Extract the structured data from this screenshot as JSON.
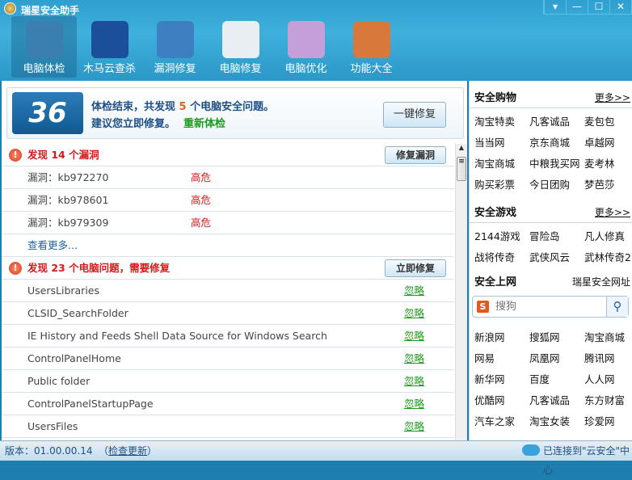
{
  "window": {
    "title": "瑞星安全助手",
    "buttons": [
      "▾",
      "—",
      "☐",
      "✕"
    ]
  },
  "toolbar": [
    {
      "label": "电脑体检",
      "icon": "monitor-pulse-icon",
      "color": "#3a7fb0",
      "active": true
    },
    {
      "label": "木马云查杀",
      "icon": "shield-icon",
      "color": "#1b4f9a"
    },
    {
      "label": "漏洞修复",
      "icon": "windows-refresh-icon",
      "color": "#3d7fc0"
    },
    {
      "label": "电脑修复",
      "icon": "checklist-icon",
      "color": "#e8eef2"
    },
    {
      "label": "电脑优化",
      "icon": "monitor-wand-icon",
      "color": "#c5a0d8"
    },
    {
      "label": "功能大全",
      "icon": "disc-box-icon",
      "color": "#d8783a"
    }
  ],
  "banner": {
    "score": "36",
    "msg_prefix": "体检结束，共发现 ",
    "count": "5",
    "msg_suffix": " 个电脑安全问题。",
    "advice": "建议您立即修复。",
    "rescan": "重新体检",
    "fix_all": "一键修复"
  },
  "vuln_section": {
    "title": "发现 14 个漏洞",
    "button": "修复漏洞",
    "items": [
      {
        "name": "漏洞：kb972270",
        "level": "高危"
      },
      {
        "name": "漏洞：kb978601",
        "level": "高危"
      },
      {
        "name": "漏洞：kb979309",
        "level": "高危"
      }
    ],
    "more": "查看更多..."
  },
  "problem_section": {
    "title": "发现 23 个电脑问题，需要修复",
    "button": "立即修复",
    "ignore": "忽略",
    "items": [
      "UsersLibraries",
      "CLSID_SearchFolder",
      "IE History and Feeds Shell Data Source for Windows Search",
      "ControlPanelHome",
      "Public folder",
      "ControlPanelStartupPage",
      "UsersFiles"
    ]
  },
  "sidebar": {
    "shopping": {
      "title": "安全购物",
      "more": "更多>>",
      "links": [
        "淘宝特卖",
        "凡客诚品",
        "麦包包",
        "当当网",
        "京东商城",
        "卓越网",
        "淘宝商城",
        "中粮我买网",
        "麦考林",
        "购买彩票",
        "今日团购",
        "梦芭莎"
      ]
    },
    "games": {
      "title": "安全游戏",
      "more": "更多>>",
      "links": [
        "2144游戏",
        "冒险岛",
        "凡人修真",
        "战将传奇",
        "武侠风云",
        "武林传奇2"
      ]
    },
    "web": {
      "title": "安全上网",
      "more": "瑞星安全网址",
      "search_placeholder": "搜狗",
      "links": [
        "新浪网",
        "搜狐网",
        "淘宝商城",
        "网易",
        "凤凰网",
        "腾讯网",
        "新华网",
        "百度",
        "人人网",
        "优酷网",
        "凡客诚品",
        "东方财富",
        "汽车之家",
        "淘宝女装",
        "珍爱网"
      ]
    }
  },
  "status": {
    "version": "版本：01.00.00.14",
    "update_open": "（",
    "update": "检查更新",
    "update_close": "）",
    "cloud": "已连接到\"云安全\"中心"
  }
}
